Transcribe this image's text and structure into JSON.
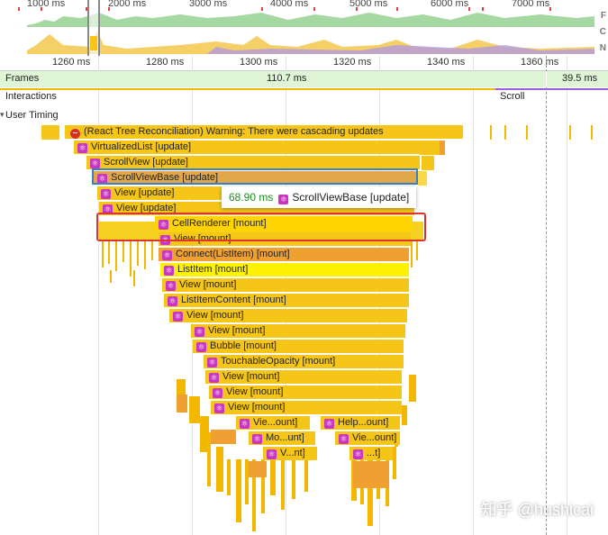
{
  "overview": {
    "time_labels": [
      "1000 ms",
      "2000 ms",
      "3000 ms",
      "4000 ms",
      "5000 ms",
      "6000 ms",
      "7000 ms"
    ],
    "row_labels": [
      "F",
      "C",
      "N"
    ]
  },
  "ruler": {
    "ticks": [
      "1260 ms",
      "1280 ms",
      "1300 ms",
      "1320 ms",
      "1340 ms",
      "1360 ms"
    ]
  },
  "tracks": {
    "frames_label": "Frames",
    "frame_time_1": "110.7 ms",
    "frame_time_2": "39.5 ms",
    "interactions_label": "Interactions",
    "interaction_scroll": "Scroll",
    "user_timing_label": "User Timing"
  },
  "flame": {
    "warning": "(React Tree Reconciliation) Warning: There were cascading updates",
    "virtualized_list": "VirtualizedList [update]",
    "scroll_view": "ScrollView [update]",
    "scroll_view_base": "ScrollViewBase [update]",
    "view_update_1": "View [update]",
    "view_update_2": "View [update]",
    "cell_renderer": "CellRenderer [mount]",
    "view_mount_1": "View [mount]",
    "connect_list_item": "Connect(ListItem) [mount]",
    "list_item": "ListItem [mount]",
    "view_mount_2": "View [mount]",
    "list_item_content": "ListItemContent [mount]",
    "view_mount_3": "View [mount]",
    "view_mount_4": "View [mount]",
    "bubble": "Bubble [mount]",
    "touchable_opacity": "TouchableOpacity [mount]",
    "view_mount_5": "View [mount]",
    "view_mount_6": "View [mount]",
    "view_mount_7": "View [mount]",
    "vie_ount": "Vie...ount]",
    "help_ount": "Help...ount]",
    "mo_unt": "Mo...unt]",
    "vie_ount_2": "Vie...ount]",
    "v_nt": "V...nt]",
    "t_short": "...t]"
  },
  "tooltip": {
    "duration": "68.90 ms",
    "name": "ScrollViewBase [update]"
  },
  "watermark": "知乎 @hushicai",
  "colors": {
    "frames_bg": "#dff5d6",
    "bar_gold": "#f5c518",
    "bar_light": "#f9d84a",
    "bar_orange": "#f0a030",
    "selected": "#e0a84a",
    "react_icon": "#c934c0",
    "highlight": "#e0332f",
    "interaction_scroll": "#9c5ee0"
  }
}
